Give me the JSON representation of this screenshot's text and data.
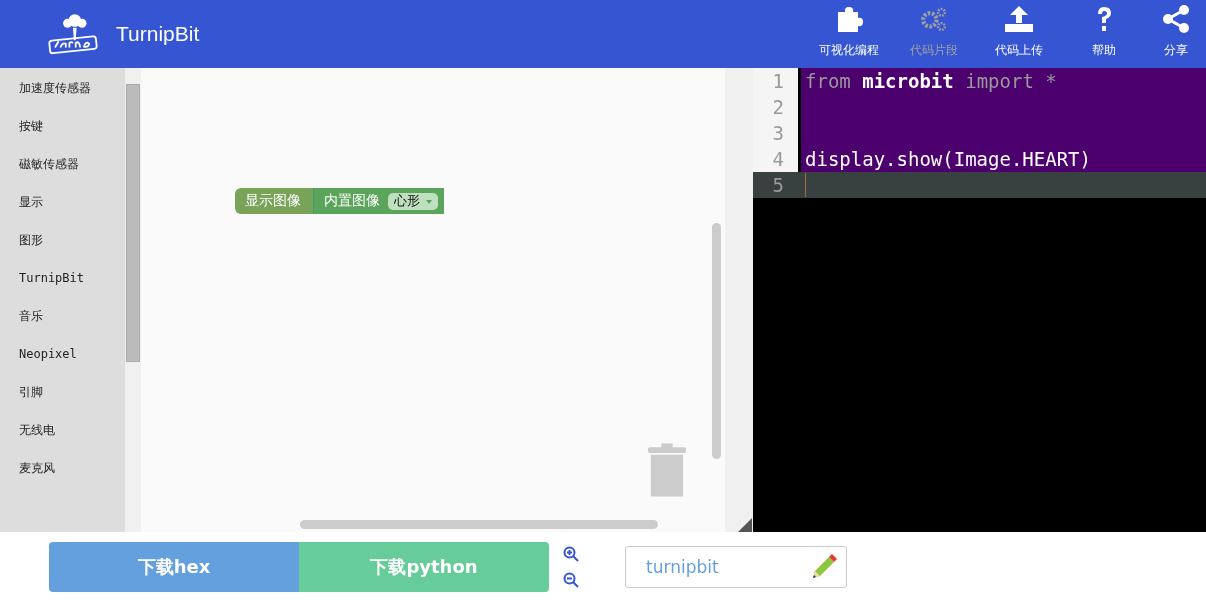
{
  "header": {
    "title": "TurnipBit",
    "nav": [
      {
        "label": "可视化编程",
        "kind": "puzzle",
        "disabled": false
      },
      {
        "label": "代码片段",
        "kind": "gears",
        "disabled": true
      },
      {
        "label": "代码上传",
        "kind": "upload",
        "disabled": false
      },
      {
        "label": "帮助",
        "kind": "help",
        "disabled": false
      },
      {
        "label": "分享",
        "kind": "share",
        "disabled": false
      }
    ]
  },
  "sidebar": {
    "items": [
      "加速度传感器",
      "按键",
      "磁敏传感器",
      "显示",
      "图形",
      "TurnipBit",
      "音乐",
      "Neopixel",
      "引脚",
      "无线电",
      "麦克风"
    ]
  },
  "workspace": {
    "block": {
      "label": "显示图像",
      "input": {
        "label": "内置图像",
        "dropdown": "心形"
      }
    }
  },
  "editor": {
    "lines": [
      {
        "number": "1",
        "active": false,
        "tokens": [
          {
            "kind": "keyword",
            "text": "from"
          },
          {
            "kind": "name",
            "text": "microbit"
          },
          {
            "kind": "keyword",
            "text": "import"
          },
          {
            "kind": "keyword",
            "text": "*"
          }
        ]
      },
      {
        "number": "2",
        "active": false
      },
      {
        "number": "3",
        "active": false
      },
      {
        "number": "4",
        "active": false,
        "tokens": [
          {
            "kind": "plain",
            "text": "display.show(Image.HEART)"
          }
        ]
      },
      {
        "number": "5",
        "active": true
      }
    ]
  },
  "footer": {
    "buttons": [
      {
        "label": "下载hex",
        "kind": "hex"
      },
      {
        "label": "下载python",
        "kind": "python"
      }
    ],
    "project_name": "turnipbit"
  }
}
